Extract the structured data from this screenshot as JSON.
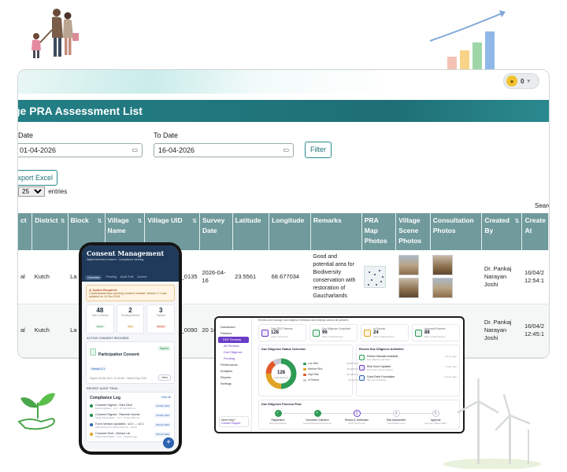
{
  "window": {
    "title": "ge PRA Assessment List",
    "notification_count": "0",
    "from_label": "Date",
    "from_value": "01-04-2026",
    "to_label": "To Date",
    "to_value": "16-04-2026",
    "filter_label": "Filter",
    "export_label": "xport Excel",
    "page_size": "25",
    "entries_label": "entries",
    "search_label": "Searc"
  },
  "table": {
    "headers": [
      "ct",
      "District",
      "Block",
      "Village Name",
      "Village UID",
      "Survey Date",
      "Latitude",
      "Longitude",
      "Remarks",
      "PRA Map Photos",
      "Village Scene Photos",
      "Consultation Photos",
      "Created By",
      "Create At"
    ],
    "rows": [
      [
        "al",
        "Kutch",
        "La",
        "",
        "M_0135",
        "2026-04-16",
        "23.5561",
        "68.677034",
        "Good and potential area for Biodiversity conservation with restoration of Gaucharlands",
        "",
        "",
        "",
        "Dr. Pankaj Narayan Joshi",
        "16/04/2 12:54:1"
      ],
      [
        "al",
        "Kutch",
        "La",
        "",
        "M_0090",
        "20 16",
        "",
        "",
        "",
        "",
        "",
        "",
        "Dr. Pankaj Narayan Joshi",
        "16/04/2 12:45:1"
      ]
    ]
  },
  "phone": {
    "app_title": "Consent Management",
    "app_subtitle": "Digital informed consent · Compliance tracking",
    "tabs": [
      "Overview",
      "Pending",
      "Audit Trail",
      "Archive"
    ],
    "alert_title": "Action Required",
    "alert_text": "3 participants have pending consent renewal. Version 2.1 was updated on 14 Dec 2024.",
    "stats": [
      {
        "n": "48",
        "l": "Total Consents",
        "p": "Active"
      },
      {
        "n": "2",
        "l": "Pending Review",
        "p": "Due"
      },
      {
        "n": "3",
        "l": "Expired",
        "p": "Renew"
      }
    ],
    "section_active": "ACTIVE CONSENT RECORDS",
    "consent_title": "Participation Consent",
    "consent_version": "Version 2.1",
    "consent_status": "Signed",
    "consent_meta": "Signed 04 Mar 2024, 10:32 AM · Valid till Sep 2025",
    "view_label": "View",
    "section_audit": "RECENT AUDIT TRAIL",
    "log_title": "Compliance Log",
    "log_view_all": "View all",
    "log_items": [
      {
        "t": "Consent Signed - Ravi Deul",
        "s": "Field Facilitator · v2.1 · IP 192.168.1.4",
        "d": "12 Mar 2024"
      },
      {
        "t": "Consent Signed - Ramesh Kumar",
        "s": "Study Participation · v2.1 · IP 192.168.1.9",
        "d": "10 Mar 2024"
      },
      {
        "t": "Form Version Updated - v2.0 → v2.1",
        "s": "Approved by Dr. Meera Sharma · Admin",
        "d": "08 Feb 2024"
      },
      {
        "t": "Consent Sent - Mohan Lal",
        "s": "Study Participation · v2.1 · awaiting sign",
        "d": "05 Feb 2024"
      }
    ],
    "fab": "+"
  },
  "dash": {
    "top_text": "Review and manage due diligence feedback and findings across all partners",
    "nav": [
      "Dashboard",
      "Partners",
      "DDF Reviews",
      "All Reviews",
      "Due Diligence",
      "Pending",
      "Performance",
      "Analytics",
      "Reports",
      "Settings"
    ],
    "help_title": "Need Help?",
    "help_link": "Contact Support",
    "kpis": [
      {
        "l": "Total DDG Partners",
        "n": "128",
        "s": "Active 12 Sectors",
        "c": "#6a3cc6"
      },
      {
        "l": "Due Diligence Completed",
        "n": "96",
        "s": "75% of Total Partners",
        "c": "#2e9b55"
      },
      {
        "l": "In Process",
        "n": "24",
        "s": "19% of Total Partners",
        "c": "#e0a322"
      },
      {
        "l": "Approved Partners",
        "n": "88",
        "s": "69% of Total Partners",
        "c": "#2e9b55"
      }
    ],
    "overview_title": "Due Diligence Status Overview",
    "donut_value": "128",
    "donut_label": "Total Partners",
    "legend": [
      {
        "l": "Low Risk",
        "p": "64 (50.0%)",
        "c": "#2e9b55"
      },
      {
        "l": "Medium Risk",
        "p": "32 (25.0%)",
        "c": "#e0a322"
      },
      {
        "l": "High Risk",
        "p": "20 (15.6%)",
        "c": "#e05a2a"
      },
      {
        "l": "In Review",
        "p": "12 (9.4%)",
        "c": "#c7cbd6"
      }
    ],
    "activity_title": "Recent Due Diligence Activities",
    "activities": [
      {
        "t": "Partner Manuals Available",
        "s": "Due diligence submitted",
        "d": "10 min ago",
        "c": "#2e9b55"
      },
      {
        "t": "Risk Score Updated",
        "s": "Document review updated",
        "d": "1 hour ago",
        "c": "#6a3cc6"
      },
      {
        "t": "Good Earth Foundation",
        "s": "Site visit scheduled",
        "d": "2 hours ago",
        "c": "#2b63b0"
      }
    ],
    "flow_title": "Due Diligence Process Flow",
    "flow": [
      {
        "l": "Registration",
        "s": "DDG Registration",
        "c": "#2e9b55"
      },
      {
        "l": "Document Collection",
        "s": "Upload Required Documents",
        "c": "#2e9b55"
      },
      {
        "l": "Review & Verification",
        "s": "Verify Documents",
        "c": "#6a3cc6"
      },
      {
        "l": "Risk Assessment",
        "s": "Assess Risk Level",
        "c": "#c7cbd6"
      },
      {
        "l": "Approval",
        "s": "Approve / Reject DDG",
        "c": "#c7cbd6"
      }
    ]
  }
}
